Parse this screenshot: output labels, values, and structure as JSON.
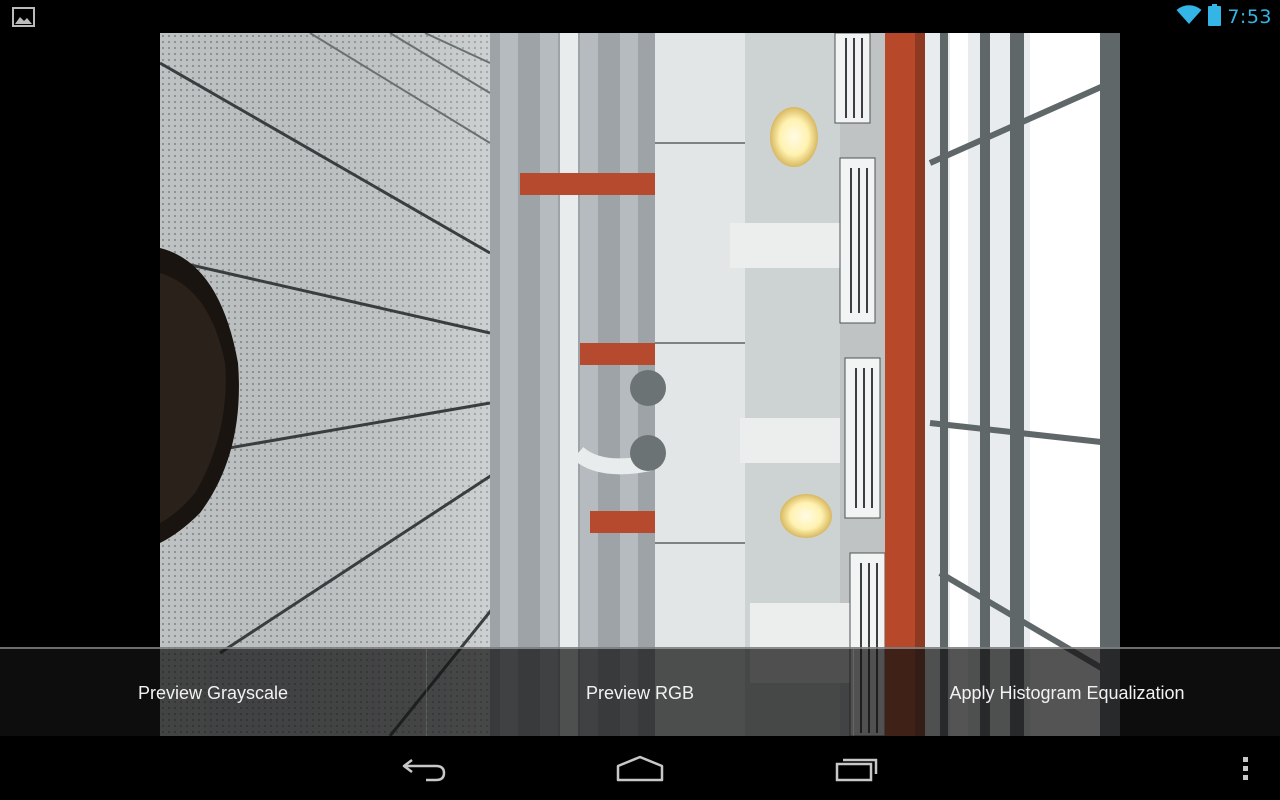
{
  "status_bar": {
    "time": "7:53",
    "left_icon": "gallery-icon",
    "wifi_icon": "wifi-icon",
    "battery_icon": "battery-icon",
    "accent_color": "#33b5e5"
  },
  "preview": {
    "description_icon": "camera-preview"
  },
  "action_bar": {
    "buttons": [
      {
        "label": "Preview Grayscale"
      },
      {
        "label": "Preview RGB"
      },
      {
        "label": "Apply Histogram Equalization"
      }
    ]
  },
  "nav_bar": {
    "back_icon": "back-icon",
    "home_icon": "home-icon",
    "recents_icon": "recents-icon",
    "menu_icon": "overflow-menu-icon"
  }
}
